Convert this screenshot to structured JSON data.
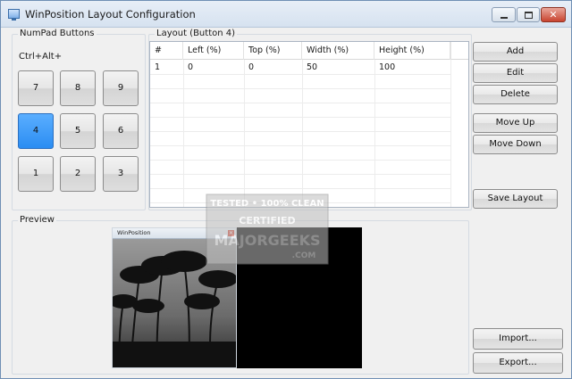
{
  "window": {
    "title": "WinPosition Layout Configuration"
  },
  "numpad": {
    "group_label": "NumPad Buttons",
    "modifier_label": "Ctrl+Alt+",
    "buttons": [
      "7",
      "8",
      "9",
      "4",
      "5",
      "6",
      "1",
      "2",
      "3"
    ],
    "active": "4"
  },
  "layout": {
    "group_label": "Layout (Button 4)",
    "columns": [
      "#",
      "Left (%)",
      "Top (%)",
      "Width (%)",
      "Height (%)"
    ],
    "rows": [
      [
        "1",
        "0",
        "0",
        "50",
        "100"
      ]
    ]
  },
  "actions": {
    "add": "Add",
    "edit": "Edit",
    "delete": "Delete",
    "move_up": "Move Up",
    "move_down": "Move Down",
    "save_layout": "Save Layout",
    "import": "Import...",
    "export": "Export..."
  },
  "preview": {
    "group_label": "Preview",
    "mini_title": "WinPosition"
  },
  "watermark": {
    "line1": "TESTED • 100% CLEAN",
    "line2": "CERTIFIED",
    "line3": "MAJORGEEKS",
    "line4": ".COM"
  },
  "colors": {
    "active_button": "#3d9cf7",
    "title_bar": "#dde7f3",
    "close_button": "#c8432f"
  }
}
